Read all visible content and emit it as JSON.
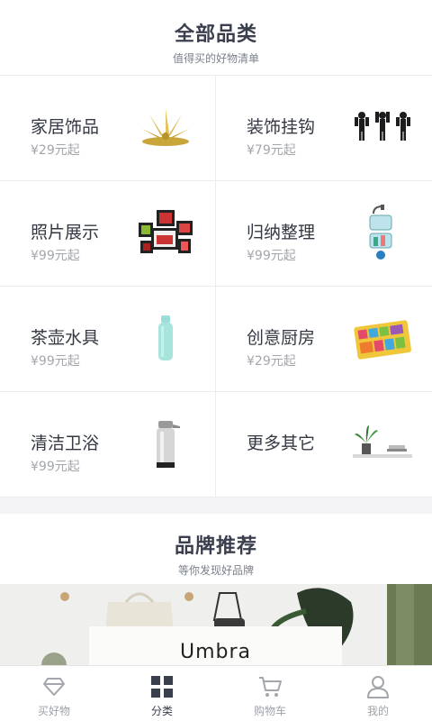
{
  "categories_section": {
    "title": "全部品类",
    "subtitle": "值得买的好物清单"
  },
  "categories": [
    {
      "name": "家居饰品",
      "price": "¥29元起",
      "icon": "gold-flower-ornament"
    },
    {
      "name": "装饰挂钩",
      "price": "¥79元起",
      "icon": "figure-wall-hooks"
    },
    {
      "name": "照片展示",
      "price": "¥99元起",
      "icon": "photo-frame-collage"
    },
    {
      "name": "归纳整理",
      "price": "¥99元起",
      "icon": "shower-caddy"
    },
    {
      "name": "茶壶水具",
      "price": "¥99元起",
      "icon": "water-bottle"
    },
    {
      "name": "创意厨房",
      "price": "¥29元起",
      "icon": "colorful-mat"
    },
    {
      "name": "清洁卫浴",
      "price": "¥99元起",
      "icon": "soap-dispenser"
    },
    {
      "name": "更多其它",
      "price": "",
      "icon": "plant-shelf"
    }
  ],
  "brand_section": {
    "title": "品牌推荐",
    "subtitle": "等你发现好品牌"
  },
  "banner": {
    "brand_name": "Umbra"
  },
  "tabbar": [
    {
      "label": "买好物",
      "icon": "diamond-icon",
      "active": false
    },
    {
      "label": "分类",
      "icon": "grid-icon",
      "active": true
    },
    {
      "label": "购物车",
      "icon": "cart-icon",
      "active": false
    },
    {
      "label": "我的",
      "icon": "user-icon",
      "active": false
    }
  ],
  "colors": {
    "text_primary": "#3a3f4d",
    "text_secondary": "#a3a6ad",
    "divider": "#ececec",
    "gap_bg": "#f4f4f6"
  }
}
